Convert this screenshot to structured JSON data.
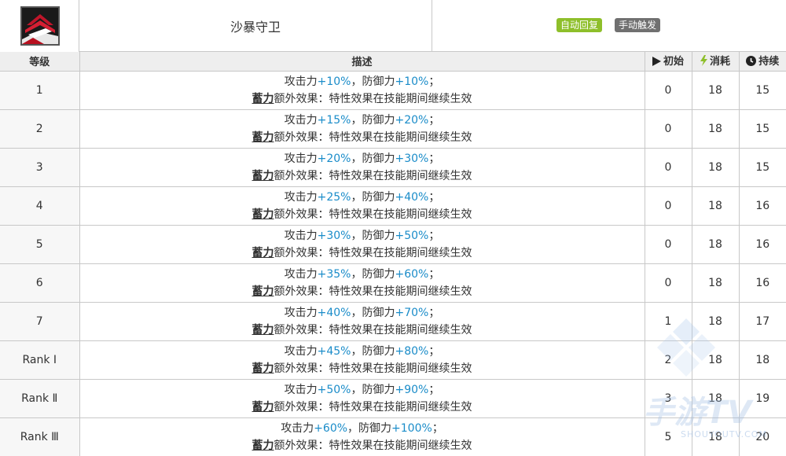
{
  "skill": {
    "name": "沙暴守卫",
    "tags": [
      "自动回复",
      "手动触发"
    ]
  },
  "table": {
    "headers": {
      "level": "等级",
      "desc": "描述",
      "initial": "初始",
      "cost": "消耗",
      "duration": "持续"
    },
    "desc_template": {
      "atk_label": "攻击力",
      "sep": "，",
      "def_label": "防御力",
      "end": "；",
      "keyword": "蓄力",
      "extra": "额外效果：特性效果在技能期间继续生效"
    },
    "rows": [
      {
        "level": "1",
        "atk": "+10%",
        "def": "+10%",
        "initial": "0",
        "cost": "18",
        "duration": "15"
      },
      {
        "level": "2",
        "atk": "+15%",
        "def": "+20%",
        "initial": "0",
        "cost": "18",
        "duration": "15"
      },
      {
        "level": "3",
        "atk": "+20%",
        "def": "+30%",
        "initial": "0",
        "cost": "18",
        "duration": "15"
      },
      {
        "level": "4",
        "atk": "+25%",
        "def": "+40%",
        "initial": "0",
        "cost": "18",
        "duration": "16"
      },
      {
        "level": "5",
        "atk": "+30%",
        "def": "+50%",
        "initial": "0",
        "cost": "18",
        "duration": "16"
      },
      {
        "level": "6",
        "atk": "+35%",
        "def": "+60%",
        "initial": "0",
        "cost": "18",
        "duration": "16"
      },
      {
        "level": "7",
        "atk": "+40%",
        "def": "+70%",
        "initial": "1",
        "cost": "18",
        "duration": "17"
      },
      {
        "level": "Rank Ⅰ",
        "atk": "+45%",
        "def": "+80%",
        "initial": "2",
        "cost": "18",
        "duration": "18"
      },
      {
        "level": "Rank Ⅱ",
        "atk": "+50%",
        "def": "+90%",
        "initial": "3",
        "cost": "18",
        "duration": "19"
      },
      {
        "level": "Rank Ⅲ",
        "atk": "+60%",
        "def": "+100%",
        "initial": "5",
        "cost": "18",
        "duration": "20"
      }
    ]
  },
  "colors": {
    "value_blue": "#1a8cc9",
    "tag_auto": "#8ebf2a",
    "tag_manual": "#707070",
    "cost_icon": "#8ebf2a"
  },
  "icons": {
    "initial": "play-icon",
    "cost": "lightning-icon",
    "duration": "clock-icon"
  },
  "watermark": {
    "text": "手游TV",
    "sub": "SHOUYOUTV.COM"
  }
}
